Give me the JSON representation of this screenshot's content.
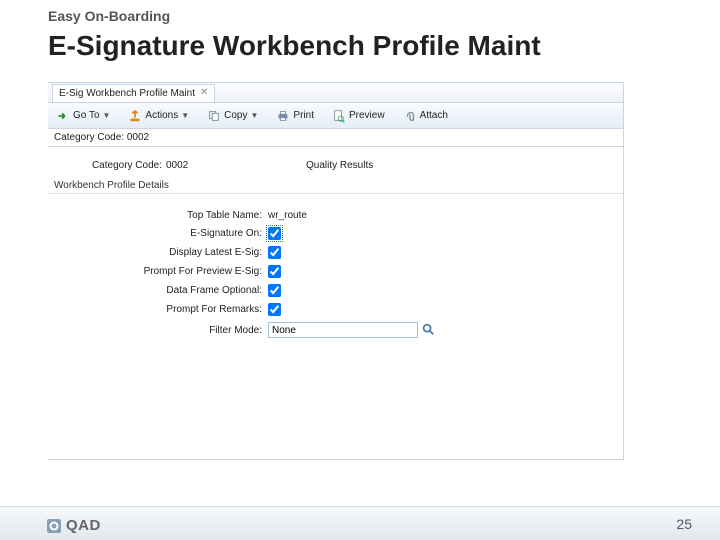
{
  "slide": {
    "subtitle": "Easy On-Boarding",
    "title": "E-Signature Workbench Profile Maint",
    "page_number": "25",
    "logo_text": "QAD"
  },
  "app": {
    "tab": {
      "label": "E-Sig Workbench Profile Maint"
    },
    "toolbar": {
      "goto": "Go To",
      "actions": "Actions",
      "copy": "Copy",
      "print": "Print",
      "preview": "Preview",
      "attach": "Attach"
    },
    "summary": {
      "text": "Category Code: 0002"
    },
    "header": {
      "category_code_label": "Category Code:",
      "category_code_value": "0002",
      "quality_results": "Quality Results"
    },
    "group_title": "Workbench Profile Details",
    "detail": {
      "top_table_name_label": "Top Table Name:",
      "top_table_name_value": "wr_route",
      "esig_on_label": "E-Signature On:",
      "esig_on_checked": true,
      "display_latest_label": "Display Latest E-Sig:",
      "display_latest_checked": true,
      "prompt_preview_label": "Prompt For Preview E-Sig:",
      "prompt_preview_checked": true,
      "data_frame_optional_label": "Data Frame Optional:",
      "data_frame_optional_checked": true,
      "prompt_remarks_label": "Prompt For Remarks:",
      "prompt_remarks_checked": true,
      "filter_mode_label": "Filter Mode:",
      "filter_mode_value": "None"
    }
  }
}
